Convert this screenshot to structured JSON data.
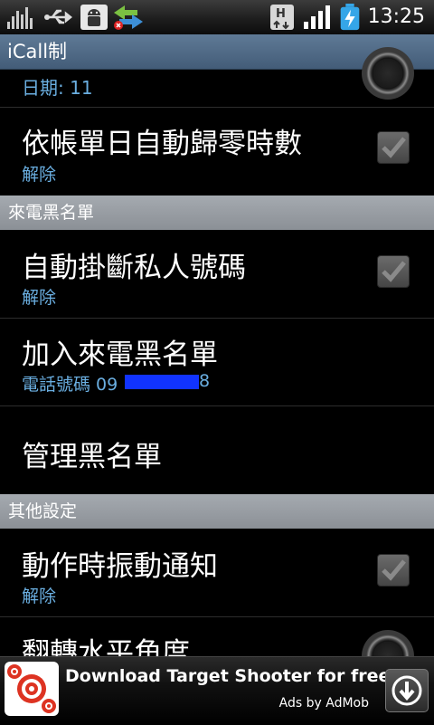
{
  "status_bar": {
    "icons_left": [
      "signal-meter-icon",
      "usb-icon",
      "android-debug-icon",
      "data-sync-icon"
    ],
    "icons_right": [
      "hspa-icon",
      "cell-signal-icon",
      "battery-charging-icon"
    ],
    "time": "13:25"
  },
  "app": {
    "title": "iCall制"
  },
  "list": {
    "partial_summary": "日期: 11",
    "item_reset_hours": {
      "title": "依帳單日自動歸零時數",
      "summary": "解除",
      "checked": false
    },
    "header_blacklist": "來電黑名單",
    "item_auto_hangup": {
      "title": "自動掛斷私人號碼",
      "summary": "解除",
      "checked": false
    },
    "item_add_blacklist": {
      "title": "加入來電黑名單",
      "summary_prefix": "電話號碼 09",
      "summary_suffix": "8"
    },
    "item_manage_blacklist": {
      "title": "管理黑名單"
    },
    "header_other": "其他設定",
    "item_vibrate": {
      "title": "動作時振動通知",
      "summary": "解除",
      "checked": false
    },
    "item_flip_angle": {
      "title": "翻轉水平角度"
    }
  },
  "ad": {
    "title": "Download Target Shooter for free!",
    "attribution": "Ads by AdMob"
  },
  "colors": {
    "accent": "#6aaee0",
    "redaction": "#1133ff",
    "title_bar": "#4f6985",
    "section_header": "#989da3"
  }
}
